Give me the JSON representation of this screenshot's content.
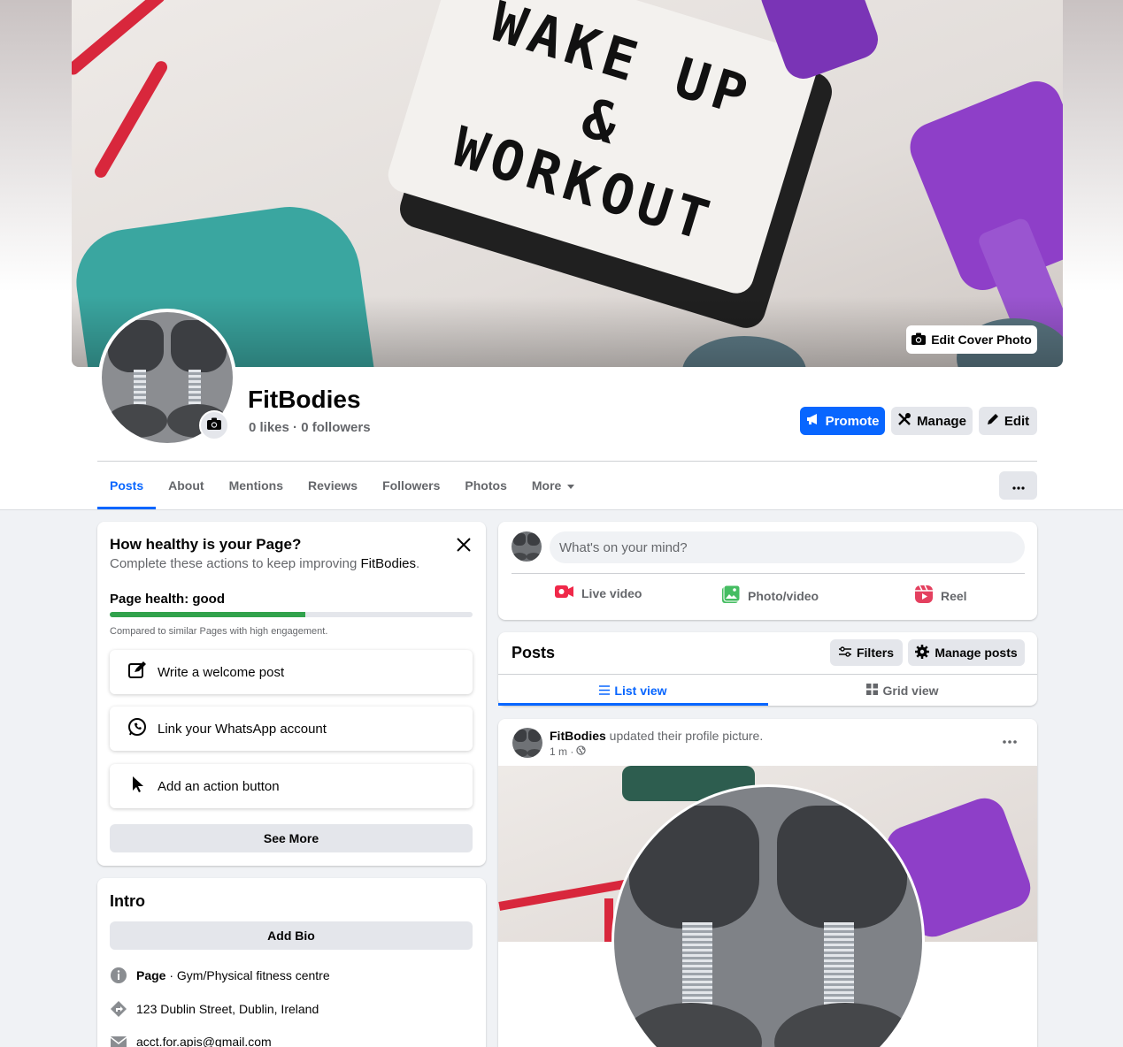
{
  "cover": {
    "text_lines": [
      "WAKE UP",
      "&",
      "WORKOUT"
    ],
    "edit_label": "Edit Cover Photo"
  },
  "page": {
    "name": "FitBodies",
    "stats": "0 likes · 0 followers"
  },
  "actions": {
    "promote": "Promote",
    "manage": "Manage",
    "edit": "Edit"
  },
  "tabs": [
    {
      "label": "Posts",
      "active": true
    },
    {
      "label": "About"
    },
    {
      "label": "Mentions"
    },
    {
      "label": "Reviews"
    },
    {
      "label": "Followers"
    },
    {
      "label": "Photos"
    },
    {
      "label": "More"
    }
  ],
  "health": {
    "title": "How healthy is your Page?",
    "subtitle_prefix": "Complete these actions to keep improving ",
    "subtitle_page": "FitBodies",
    "subtitle_suffix": ".",
    "status": "Page health: good",
    "progress": 0.54,
    "compare_note": "Compared to similar Pages with high engagement.",
    "items": [
      {
        "label": "Write a welcome post",
        "icon": "compose-icon"
      },
      {
        "label": "Link your WhatsApp account",
        "icon": "whatsapp-icon"
      },
      {
        "label": "Add an action button",
        "icon": "cursor-icon"
      }
    ],
    "see_more": "See More"
  },
  "intro": {
    "title": "Intro",
    "add_bio": "Add Bio",
    "category_bold": "Page",
    "category_rest": " · Gym/Physical fitness centre",
    "address": "123 Dublin Street, Dublin, Ireland",
    "email": "acct.for.apis@gmail.com"
  },
  "composer": {
    "placeholder": "What's on your mind?",
    "live": "Live video",
    "photo": "Photo/video",
    "reel": "Reel"
  },
  "posts_section": {
    "title": "Posts",
    "filters": "Filters",
    "manage_posts": "Manage posts",
    "list_view": "List view",
    "grid_view": "Grid view"
  },
  "post": {
    "author": "FitBodies",
    "action": " updated their profile picture.",
    "time": "1 m ·"
  },
  "colors": {
    "accent": "#0866ff",
    "health_good": "#31a24c"
  }
}
